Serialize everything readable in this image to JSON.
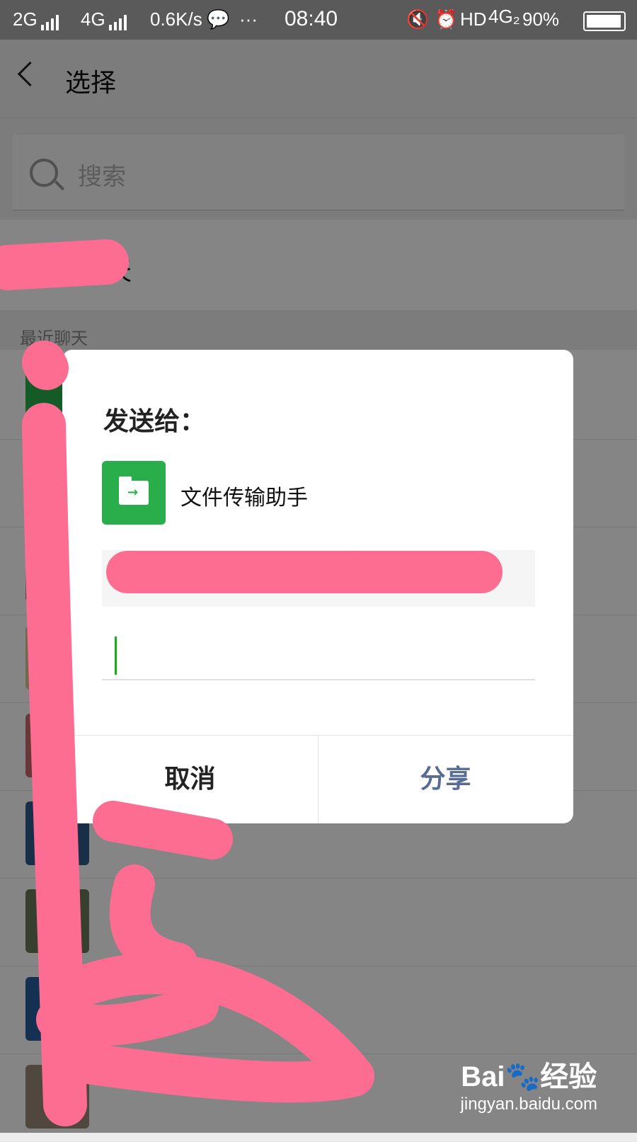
{
  "status_bar": {
    "net1": "2G",
    "net2": "4G",
    "speed": "0.6K/s",
    "more": "···",
    "time": "08:40",
    "hd": "HD",
    "net3": "4G₂",
    "battery": "90%"
  },
  "nav": {
    "title": "选择"
  },
  "search": {
    "placeholder": "搜索"
  },
  "new_chat": {
    "label": "天"
  },
  "recent": {
    "section_label": "最近聊天"
  },
  "dialog": {
    "title": "发送给：",
    "target_name": "文件传输助手",
    "preview_prefix": "[",
    "cancel_label": "取消",
    "share_label": "分享"
  },
  "watermark": {
    "logo": "Bai🐾经验",
    "url": "jingyan.baidu.com"
  },
  "colors": {
    "share_blue": "#576b95",
    "accent_green": "#2aae4c",
    "scribble_pink": "#fd6d91"
  }
}
